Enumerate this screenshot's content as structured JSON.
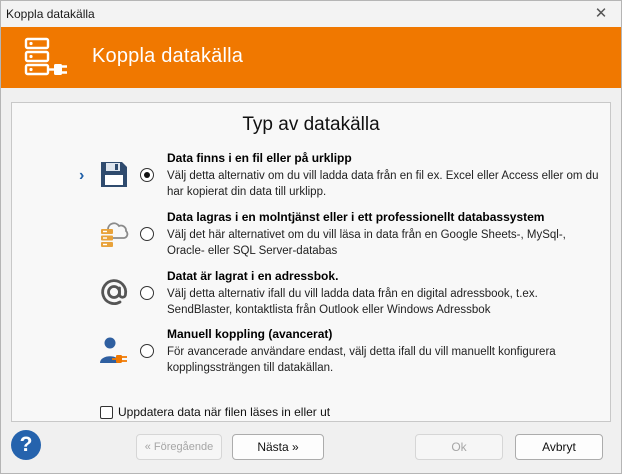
{
  "window": {
    "title": "Koppla datakälla",
    "close_glyph": "✕"
  },
  "banner": {
    "heading": "Koppla datakälla",
    "icon": "database-plug-icon",
    "color": "#f07800"
  },
  "panel": {
    "section_title": "Typ av datakälla",
    "selected_marker": "›",
    "options": [
      {
        "title": "Data finns i en fil eller på urklipp",
        "description": "Välj detta alternativ om du vill ladda data från en fil ex. Excel eller Access eller om du har kopierat din data till urklipp.",
        "icon": "floppy-disk-icon",
        "selected": true
      },
      {
        "title": "Data lagras i en molntjänst eller i ett professionellt databassystem",
        "description": "Välj det här alternativet om du vill läsa in data från en Google Sheets-, MySql-, Oracle- eller SQL Server-databas",
        "icon": "cloud-database-icon",
        "selected": false
      },
      {
        "title": "Datat är lagrat i en adressbok.",
        "description": "Välj detta alternativ ifall du vill ladda data från en digital adressbook, t.ex. SendBlaster, kontaktlista från Outlook eller Windows Adressbok",
        "icon": "at-sign-icon",
        "selected": false
      },
      {
        "title": "Manuell koppling (avancerat)",
        "description": "För avancerade användare endast, välj detta ifall du vill manuellt konfigurera kopplingssträngen till datakällan.",
        "icon": "user-plug-icon",
        "selected": false
      }
    ],
    "checkbox": {
      "label": "Uppdatera data när filen läses in eller ut",
      "checked": false
    }
  },
  "footer": {
    "help_label": "?",
    "prev_label": "« Föregående",
    "next_label": "Nästa »",
    "ok_label": "Ok",
    "cancel_label": "Avbryt"
  }
}
